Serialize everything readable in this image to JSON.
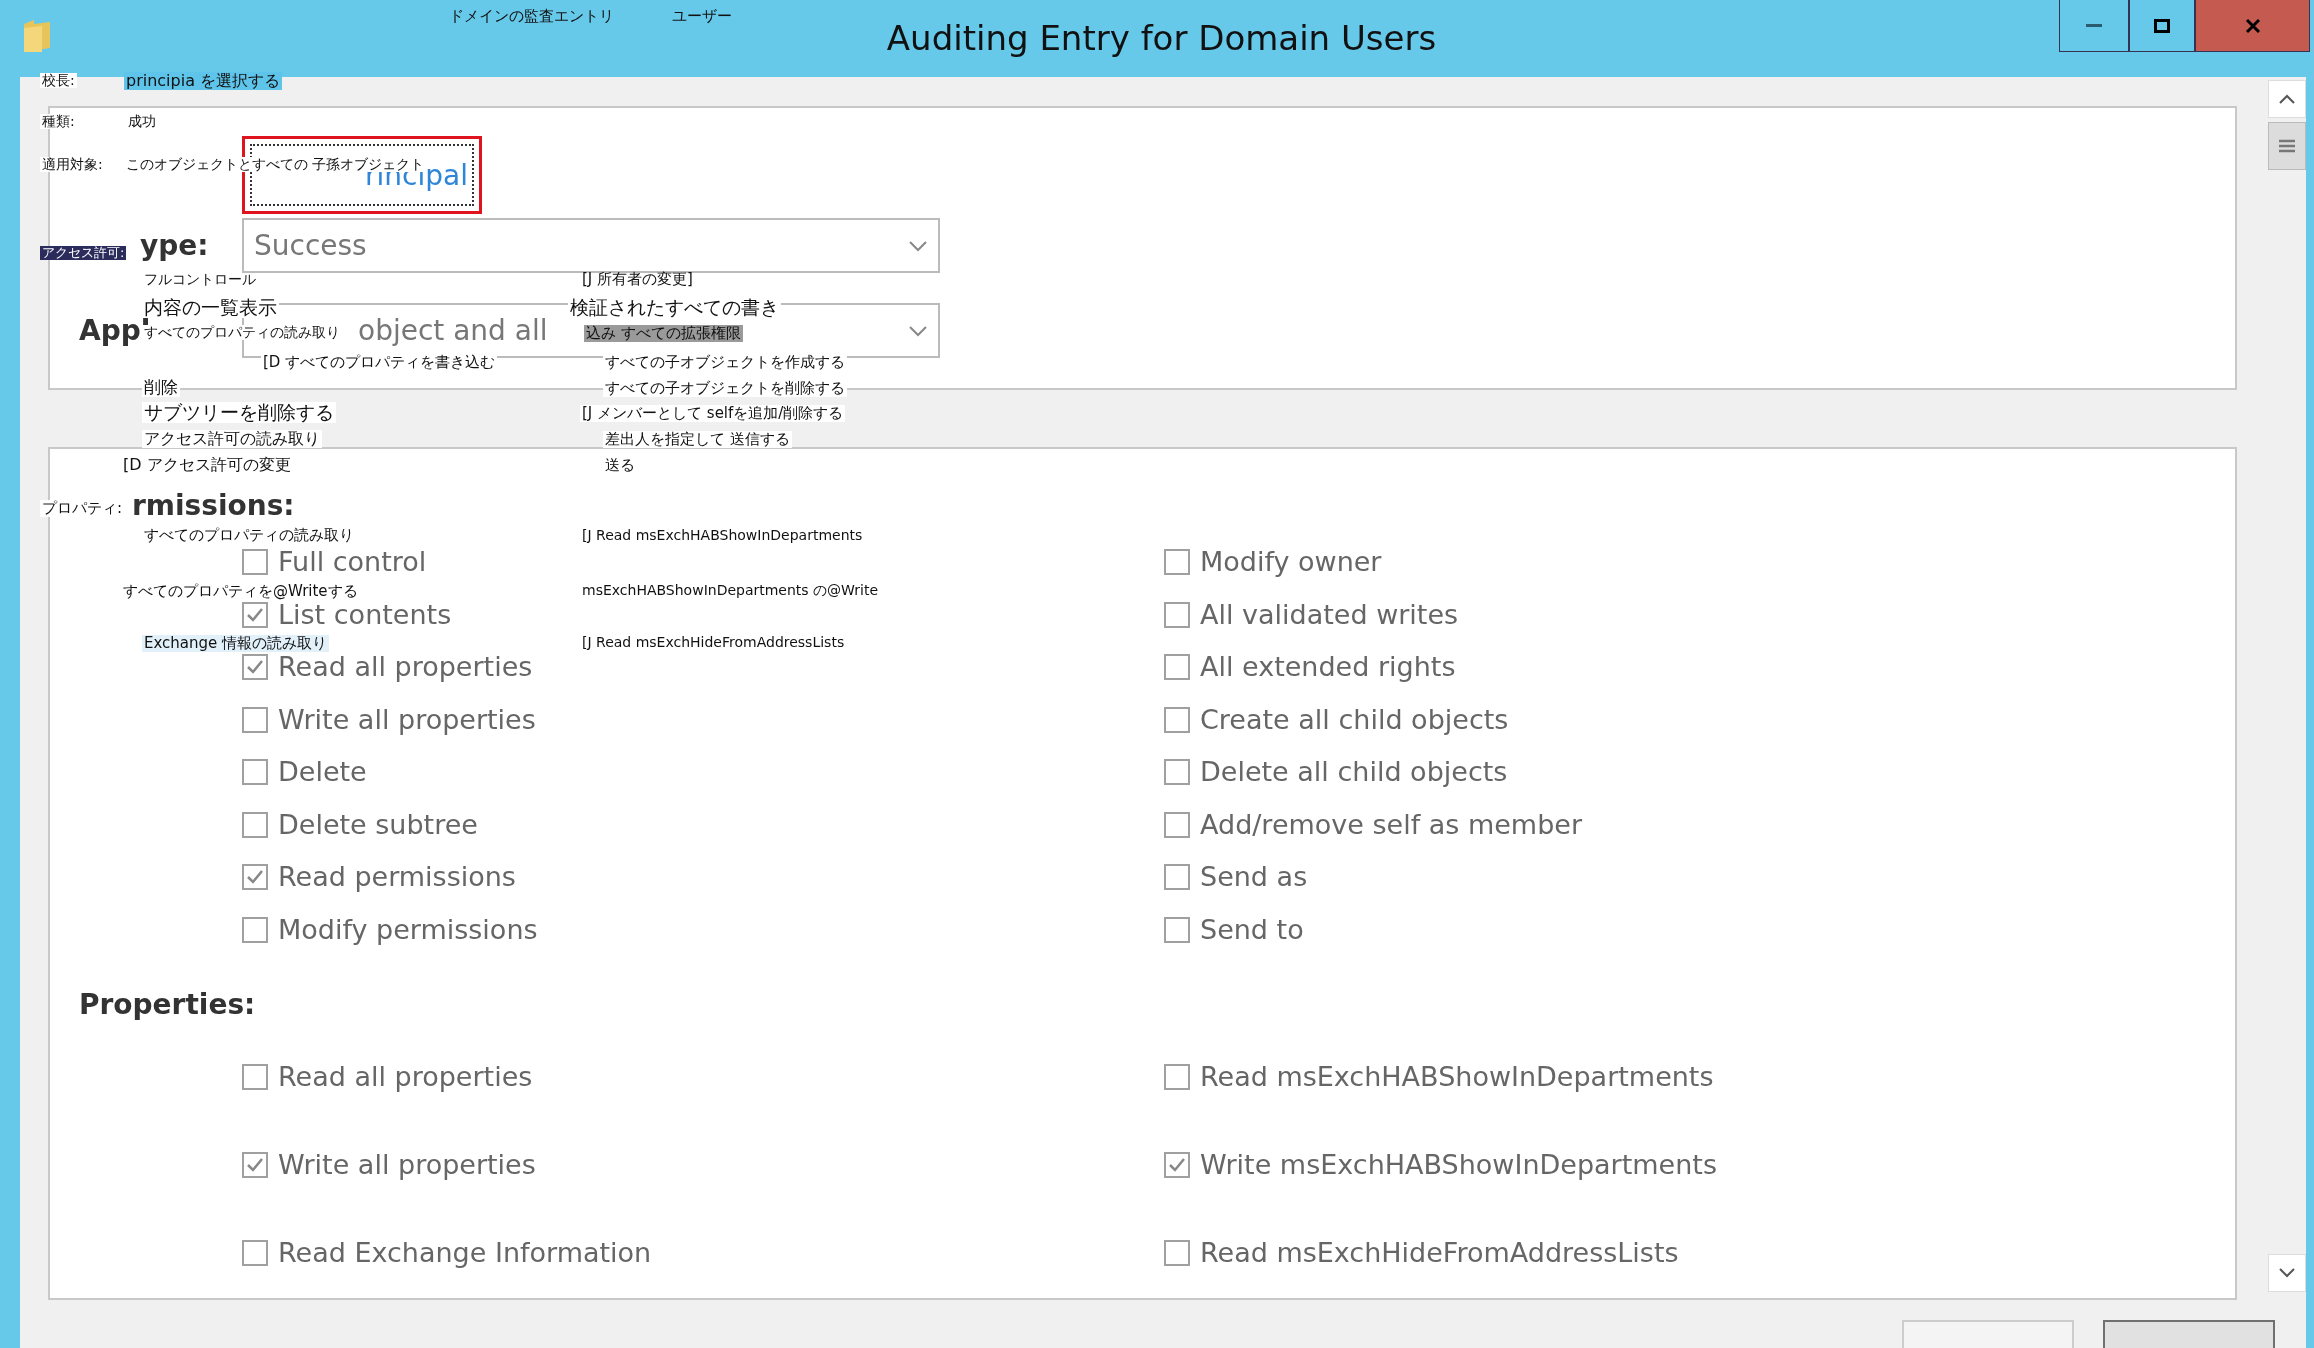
{
  "window": {
    "title": "Auditing Entry for Domain Users"
  },
  "principal": {
    "link": "rincipal"
  },
  "type": {
    "label": "ype:",
    "value": "Success"
  },
  "applies_to": {
    "label": "Appl",
    "value": "object and all"
  },
  "permissions": {
    "label": "rmissions:",
    "items": [
      {
        "label": "Full control",
        "checked": false
      },
      {
        "label": "Modify owner",
        "checked": false
      },
      {
        "label": "List contents",
        "checked": true
      },
      {
        "label": "All validated writes",
        "checked": false
      },
      {
        "label": "Read all properties",
        "checked": true
      },
      {
        "label": "All extended rights",
        "checked": false
      },
      {
        "label": "Write all properties",
        "checked": false
      },
      {
        "label": "Create all child objects",
        "checked": false
      },
      {
        "label": "Delete",
        "checked": false
      },
      {
        "label": "Delete all child objects",
        "checked": false
      },
      {
        "label": "Delete subtree",
        "checked": false
      },
      {
        "label": "Add/remove self as member",
        "checked": false
      },
      {
        "label": "Read permissions",
        "checked": true
      },
      {
        "label": "Send as",
        "checked": false
      },
      {
        "label": "Modify permissions",
        "checked": false
      },
      {
        "label": "Send to",
        "checked": false
      }
    ]
  },
  "properties": {
    "label": "Properties:",
    "items": [
      {
        "label": "Read all properties",
        "checked": false
      },
      {
        "label": "Read msExchHABShowInDepartments",
        "checked": false
      },
      {
        "label": "Write all properties",
        "checked": true
      },
      {
        "label": "Write msExchHABShowInDepartments",
        "checked": true
      },
      {
        "label": "Read Exchange Information",
        "checked": false
      },
      {
        "label": "Read msExchHideFromAddressLists",
        "checked": false
      }
    ]
  },
  "overlay_labels": [
    {
      "text": "ドメインの監査エントリ",
      "kind": "plain"
    },
    {
      "text": "ユーザー",
      "kind": "plain"
    },
    {
      "text": "校長:",
      "kind": "white"
    },
    {
      "text": "principia を選択する",
      "kind": "blue"
    },
    {
      "text": "種類:",
      "kind": "white"
    },
    {
      "text": "成功",
      "kind": "plain"
    },
    {
      "text": "適用対象:",
      "kind": "white"
    },
    {
      "text": "このオブジェクトとすべての 子孫オブジェクト",
      "kind": "white"
    },
    {
      "text": "アクセス許可:",
      "kind": "dark"
    },
    {
      "text": "フルコントロール",
      "kind": "plain"
    },
    {
      "text": "[J 所有者の変更]",
      "kind": "plain"
    },
    {
      "text": "内容の一覧表示",
      "kind": "white"
    },
    {
      "text": "検証されたすべての書き",
      "kind": "white"
    },
    {
      "text": "すべてのプロパティの読み取り",
      "kind": "white"
    },
    {
      "text": "込み すべての拡張権限",
      "kind": "gray"
    },
    {
      "text": "[D すべてのプロパティを書き込む",
      "kind": "white"
    },
    {
      "text": "すべての子オブジェクトを作成する",
      "kind": "white"
    },
    {
      "text": "削除",
      "kind": "white"
    },
    {
      "text": "すべての子オブジェクトを削除する",
      "kind": "white"
    },
    {
      "text": "サブツリーを削除する",
      "kind": "white"
    },
    {
      "text": "[J メンバーとして selfを追加/削除する",
      "kind": "white"
    },
    {
      "text": "アクセス許可の読み取り",
      "kind": "white"
    },
    {
      "text": "差出人を指定して 送信する",
      "kind": "white"
    },
    {
      "text": "[D アクセス許可の変更",
      "kind": "white"
    },
    {
      "text": "送る",
      "kind": "white"
    },
    {
      "text": "プロパティ:",
      "kind": "white"
    },
    {
      "text": "すべてのプロパティの読み取り",
      "kind": "white"
    },
    {
      "text": "[J Read msExchHABShowInDepartments",
      "kind": "white"
    },
    {
      "text": "すべてのプロパティを@Writeする",
      "kind": "white"
    },
    {
      "text": "msExchHABShowInDepartments の@Write",
      "kind": "white"
    },
    {
      "text": "Exchange 情報の読み取り",
      "kind": "pale"
    },
    {
      "text": "[J Read msExchHideFromAddressLists",
      "kind": "white"
    }
  ]
}
